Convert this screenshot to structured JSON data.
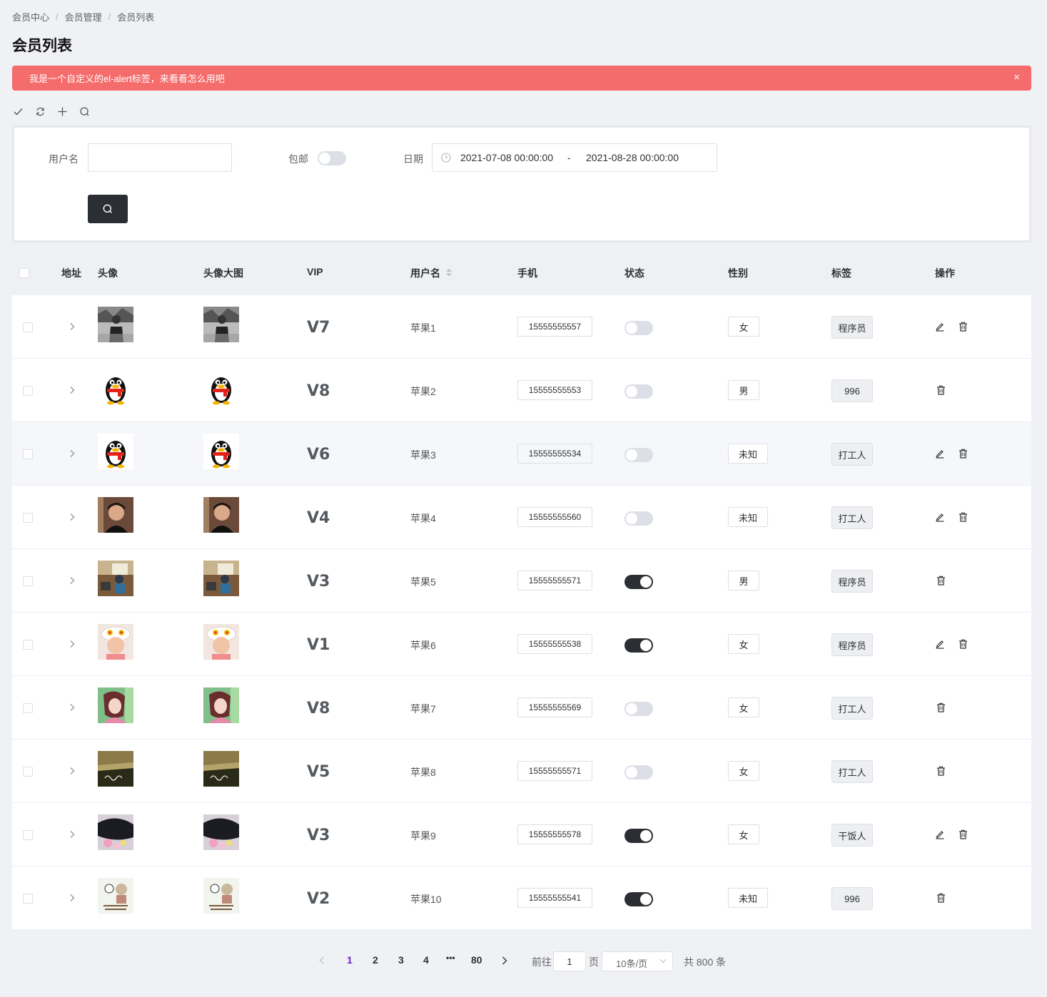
{
  "breadcrumb": [
    "会员中心",
    "会员管理",
    "会员列表"
  ],
  "page_title": "会员列表",
  "alert": {
    "text": "我是一个自定义的el-alert标签，来看看怎么用吧",
    "close": "×",
    "color": "#f56c6c"
  },
  "toolbar": [
    "check-icon",
    "refresh-icon",
    "plus-icon",
    "search-icon"
  ],
  "search_form": {
    "username_label": "用户名",
    "username_value": "",
    "free_shipping_label": "包邮",
    "free_shipping_on": false,
    "date_label": "日期",
    "date_start": "2021-07-08 00:00:00",
    "date_sep": "-",
    "date_end": "2021-08-28 00:00:00"
  },
  "table": {
    "headers": {
      "address": "地址",
      "avatar": "头像",
      "avatar_large": "头像大图",
      "vip": "VIP",
      "username": "用户名",
      "phone": "手机",
      "status": "状态",
      "gender": "性别",
      "tag": "标签",
      "actions": "操作"
    },
    "rows": [
      {
        "vip": "V7",
        "username": "苹果1",
        "phone": "15555555557",
        "status": false,
        "gender": "女",
        "tag": "程序员",
        "editable": true,
        "avatar": "man-outdoor-bw"
      },
      {
        "vip": "V8",
        "username": "苹果2",
        "phone": "15555555553",
        "status": false,
        "gender": "男",
        "tag": "996",
        "editable": false,
        "avatar": "qq-penguin"
      },
      {
        "vip": "V6",
        "username": "苹果3",
        "phone": "15555555534",
        "status": false,
        "gender": "未知",
        "tag": "打工人",
        "editable": true,
        "avatar": "qq-penguin"
      },
      {
        "vip": "V4",
        "username": "苹果4",
        "phone": "15555555560",
        "status": false,
        "gender": "未知",
        "tag": "打工人",
        "editable": true,
        "avatar": "boy-portrait"
      },
      {
        "vip": "V3",
        "username": "苹果5",
        "phone": "15555555571",
        "status": true,
        "gender": "男",
        "tag": "程序员",
        "editable": false,
        "avatar": "classroom"
      },
      {
        "vip": "V1",
        "username": "苹果6",
        "phone": "15555555538",
        "status": true,
        "gender": "女",
        "tag": "程序员",
        "editable": true,
        "avatar": "kid-hat"
      },
      {
        "vip": "V8",
        "username": "苹果7",
        "phone": "15555555569",
        "status": false,
        "gender": "女",
        "tag": "打工人",
        "editable": false,
        "avatar": "anime-girl"
      },
      {
        "vip": "V5",
        "username": "苹果8",
        "phone": "15555555571",
        "status": false,
        "gender": "女",
        "tag": "打工人",
        "editable": false,
        "avatar": "dark-sign"
      },
      {
        "vip": "V3",
        "username": "苹果9",
        "phone": "15555555578",
        "status": true,
        "gender": "女",
        "tag": "干饭人",
        "editable": true,
        "avatar": "dark-flowers"
      },
      {
        "vip": "V2",
        "username": "苹果10",
        "phone": "15555555541",
        "status": true,
        "gender": "未知",
        "tag": "996",
        "editable": false,
        "avatar": "cartoon-meme"
      }
    ]
  },
  "pagination": {
    "pages": [
      "1",
      "2",
      "3",
      "4",
      "80"
    ],
    "ellipsis": "•••",
    "current": "1",
    "goto_label": "前往",
    "goto_value": "1",
    "goto_unit": "页",
    "page_size": "10条/页",
    "total": "共 800 条"
  },
  "colors": {
    "accent": "#2b2e33",
    "active_page": "#6a1fd1",
    "header_bg": "#eef0f4"
  }
}
